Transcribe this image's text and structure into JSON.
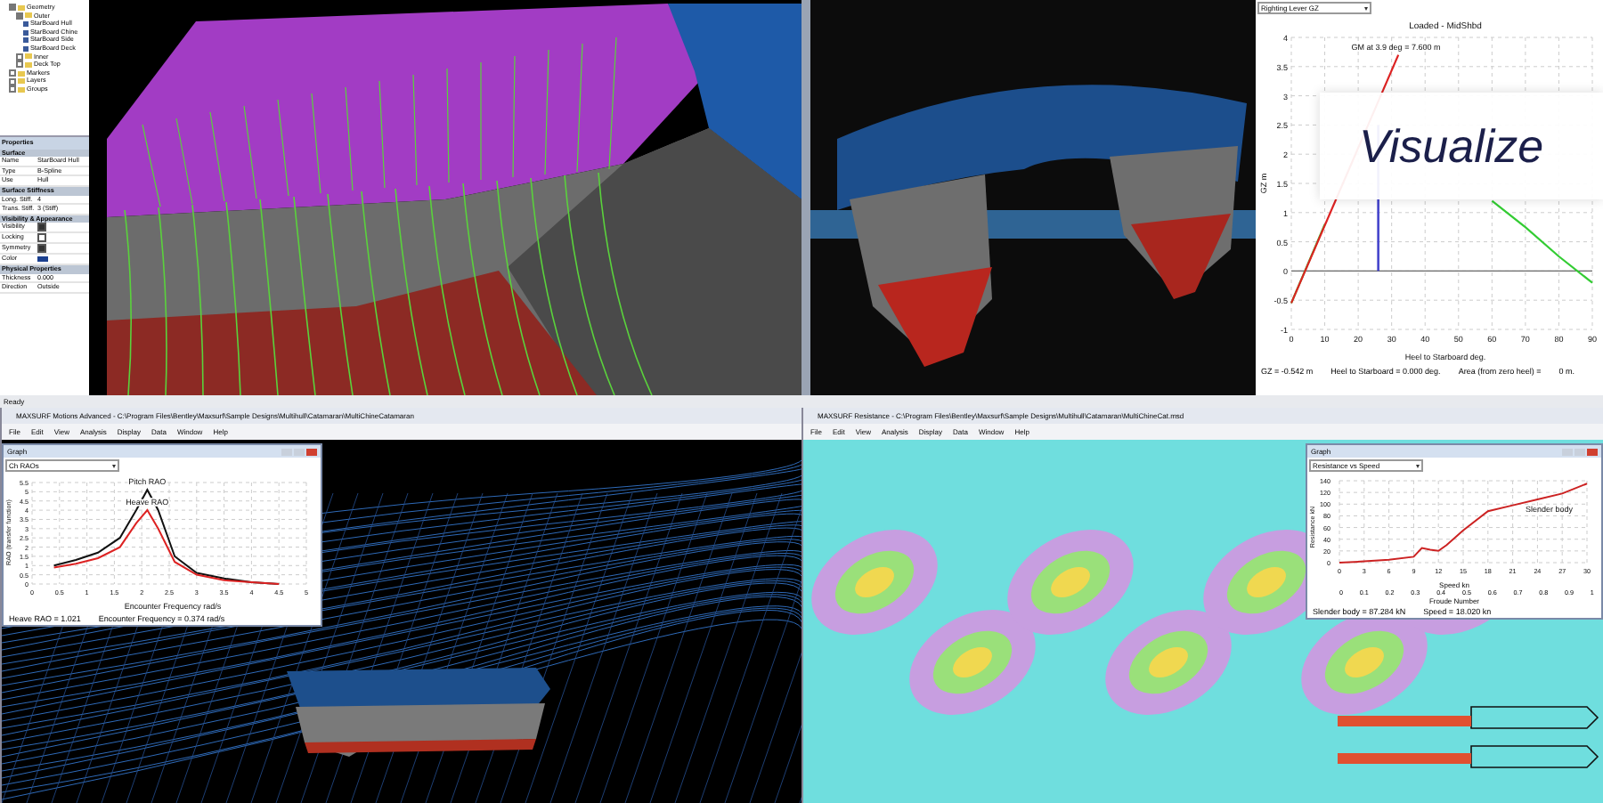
{
  "model_tree": [
    {
      "label": "Geometry",
      "expanded": true,
      "children": [
        {
          "label": "Outer",
          "expanded": true,
          "children": [
            {
              "label": "StarBoard Hull"
            },
            {
              "label": "StarBoard Chine"
            },
            {
              "label": "StarBoard Side"
            },
            {
              "label": "StarBoard Deck"
            }
          ]
        },
        {
          "label": "Inner",
          "expanded": false
        },
        {
          "label": "Deck Top",
          "expanded": false
        }
      ]
    },
    {
      "label": "Markers",
      "expanded": false
    },
    {
      "label": "Layers",
      "expanded": false
    },
    {
      "label": "Groups",
      "expanded": false
    }
  ],
  "properties": {
    "title": "Properties",
    "rows": [
      {
        "kind": "section",
        "label": "Surface"
      },
      {
        "kind": "text",
        "label": "Name",
        "value": "StarBoard Hull"
      },
      {
        "kind": "text",
        "label": "Type",
        "value": "B-Spline"
      },
      {
        "kind": "text",
        "label": "Use",
        "value": "Hull"
      },
      {
        "kind": "section",
        "label": "Surface Stiffness"
      },
      {
        "kind": "text",
        "label": "Long. Stiff.",
        "value": "4"
      },
      {
        "kind": "text",
        "label": "Trans. Stiff.",
        "value": "3 (Stiff)"
      },
      {
        "kind": "section",
        "label": "Visibility & Appearance"
      },
      {
        "kind": "check",
        "label": "Visibility",
        "checked": true
      },
      {
        "kind": "check",
        "label": "Locking",
        "checked": false
      },
      {
        "kind": "check",
        "label": "Symmetry",
        "checked": true
      },
      {
        "kind": "color",
        "label": "Color",
        "color": "#1a3f8f"
      },
      {
        "kind": "section",
        "label": "Physical Properties"
      },
      {
        "kind": "text",
        "label": "Thickness",
        "value": "0.000"
      },
      {
        "kind": "text",
        "label": "Direction",
        "value": "Outside"
      }
    ]
  },
  "top_status": {
    "text": "Ready"
  },
  "gz_panel": {
    "dropdown": "Righting Lever GZ",
    "overlay": "Visualize",
    "chart_data": {
      "type": "line",
      "title": "Loaded - MidShbd",
      "xlabel": "Heel to Starboard  deg.",
      "ylabel": "GZ  m",
      "grid": true,
      "x": [
        0,
        10,
        20,
        26,
        32,
        40,
        50,
        60,
        70,
        80,
        90
      ],
      "series": [
        {
          "color": "#33cc33",
          "values": [
            -0.55,
            0.8,
            null,
            null,
            null,
            null,
            null,
            1.2,
            0.75,
            0.25,
            -0.2
          ]
        },
        {
          "color": "#dd2222",
          "values": [
            -0.55,
            null,
            null,
            null,
            3.7,
            null,
            null,
            null,
            null,
            null,
            null
          ]
        }
      ],
      "xlim": [
        0,
        90
      ],
      "ylim": [
        -1,
        4
      ],
      "xticks": [
        0,
        10,
        20,
        30,
        40,
        50,
        60,
        70,
        80,
        90
      ],
      "yticks": [
        -1,
        -0.5,
        0,
        0.5,
        1,
        1.5,
        2,
        2.5,
        3,
        3.5,
        4
      ],
      "ref_lines": [
        {
          "axis": "x",
          "value": 26,
          "color": "#4444cc"
        }
      ],
      "annotations": [
        "GM at 3.9 deg = 7.600 m"
      ]
    },
    "readouts": [
      "GZ = -0.542 m",
      "Heel to Starboard = 0.000  deg.",
      "Area (from zero heel) =",
      "0 m."
    ]
  },
  "motions_window": {
    "title": "MAXSURF Motions Advanced - C:\\Program Files\\Bentley\\Maxsurf\\Sample Designs\\Multihull\\Catamaran\\MultiChineCatamaran",
    "menu": [
      "File",
      "Edit",
      "View",
      "Analysis",
      "Display",
      "Data",
      "Window",
      "Help"
    ],
    "graph": {
      "title": "Graph",
      "dropdown": "Ch RAOs",
      "chart_data": {
        "type": "line",
        "xlabel": "Encounter Frequency  rad/s",
        "ylabel": "RAO (transfer function)",
        "grid": true,
        "x": [
          0.4,
          0.8,
          1.2,
          1.6,
          1.9,
          2.1,
          2.3,
          2.6,
          3,
          3.5,
          4,
          4.5
        ],
        "series": [
          {
            "name": "Pitch RAO",
            "color": "#111111",
            "values": [
              1.0,
              1.3,
              1.7,
              2.5,
              4.0,
              5.1,
              4.0,
              1.5,
              0.6,
              0.3,
              0.1,
              0
            ]
          },
          {
            "name": "Heave RAO",
            "color": "#dd2222",
            "values": [
              0.9,
              1.1,
              1.4,
              2.0,
              3.3,
              4.0,
              3.0,
              1.2,
              0.5,
              0.2,
              0.1,
              0
            ]
          }
        ],
        "xlim": [
          0,
          5
        ],
        "ylim": [
          0,
          5.5
        ],
        "xticks": [
          0,
          0.5,
          1,
          1.5,
          2,
          2.5,
          3,
          3.5,
          4,
          4.5,
          5
        ],
        "yticks": [
          0,
          0.5,
          1,
          1.5,
          2,
          2.5,
          3,
          3.5,
          4,
          4.5,
          5,
          5.5
        ]
      },
      "readouts": [
        "Heave RAO =  1.021",
        "Encounter Frequency = 0.374 rad/s"
      ]
    }
  },
  "resistance_window": {
    "title": "MAXSURF Resistance - C:\\Program Files\\Bentley\\Maxsurf\\Sample Designs\\Multihull\\Catamaran\\MultiChineCat.msd",
    "menu": [
      "File",
      "Edit",
      "View",
      "Analysis",
      "Display",
      "Data",
      "Window",
      "Help"
    ],
    "graph": {
      "title": "Graph",
      "dropdown": "Resistance vs Speed",
      "chart_data": {
        "type": "line",
        "xlabel": "Speed  kn",
        "ylabel": "Resistance  kN",
        "grid": true,
        "x": [
          0,
          3,
          6,
          9,
          10,
          11,
          12,
          13,
          15,
          18,
          21,
          24,
          27,
          30
        ],
        "series": [
          {
            "name": "Slender body",
            "color": "#cc2222",
            "values": [
              0,
              2,
              5,
              10,
              25,
              22,
              20,
              30,
              55,
              88,
              98,
              108,
              118,
              135
            ]
          }
        ],
        "xlim": [
          0,
          30
        ],
        "ylim": [
          0,
          140
        ],
        "xticks": [
          0,
          3,
          6,
          9,
          12,
          15,
          18,
          21,
          24,
          27,
          30
        ],
        "yticks": [
          0,
          20,
          40,
          60,
          80,
          100,
          120,
          140
        ]
      },
      "froude_ticks": [
        "0",
        "0.1",
        "0.2",
        "0.3",
        "0.4",
        "0.5",
        "0.6",
        "0.7",
        "0.8",
        "0.9",
        "1"
      ],
      "froude_label": "Froude Number",
      "readouts": [
        "Slender body  =  87.284 kN",
        "Speed =  18.020 kn"
      ]
    }
  }
}
